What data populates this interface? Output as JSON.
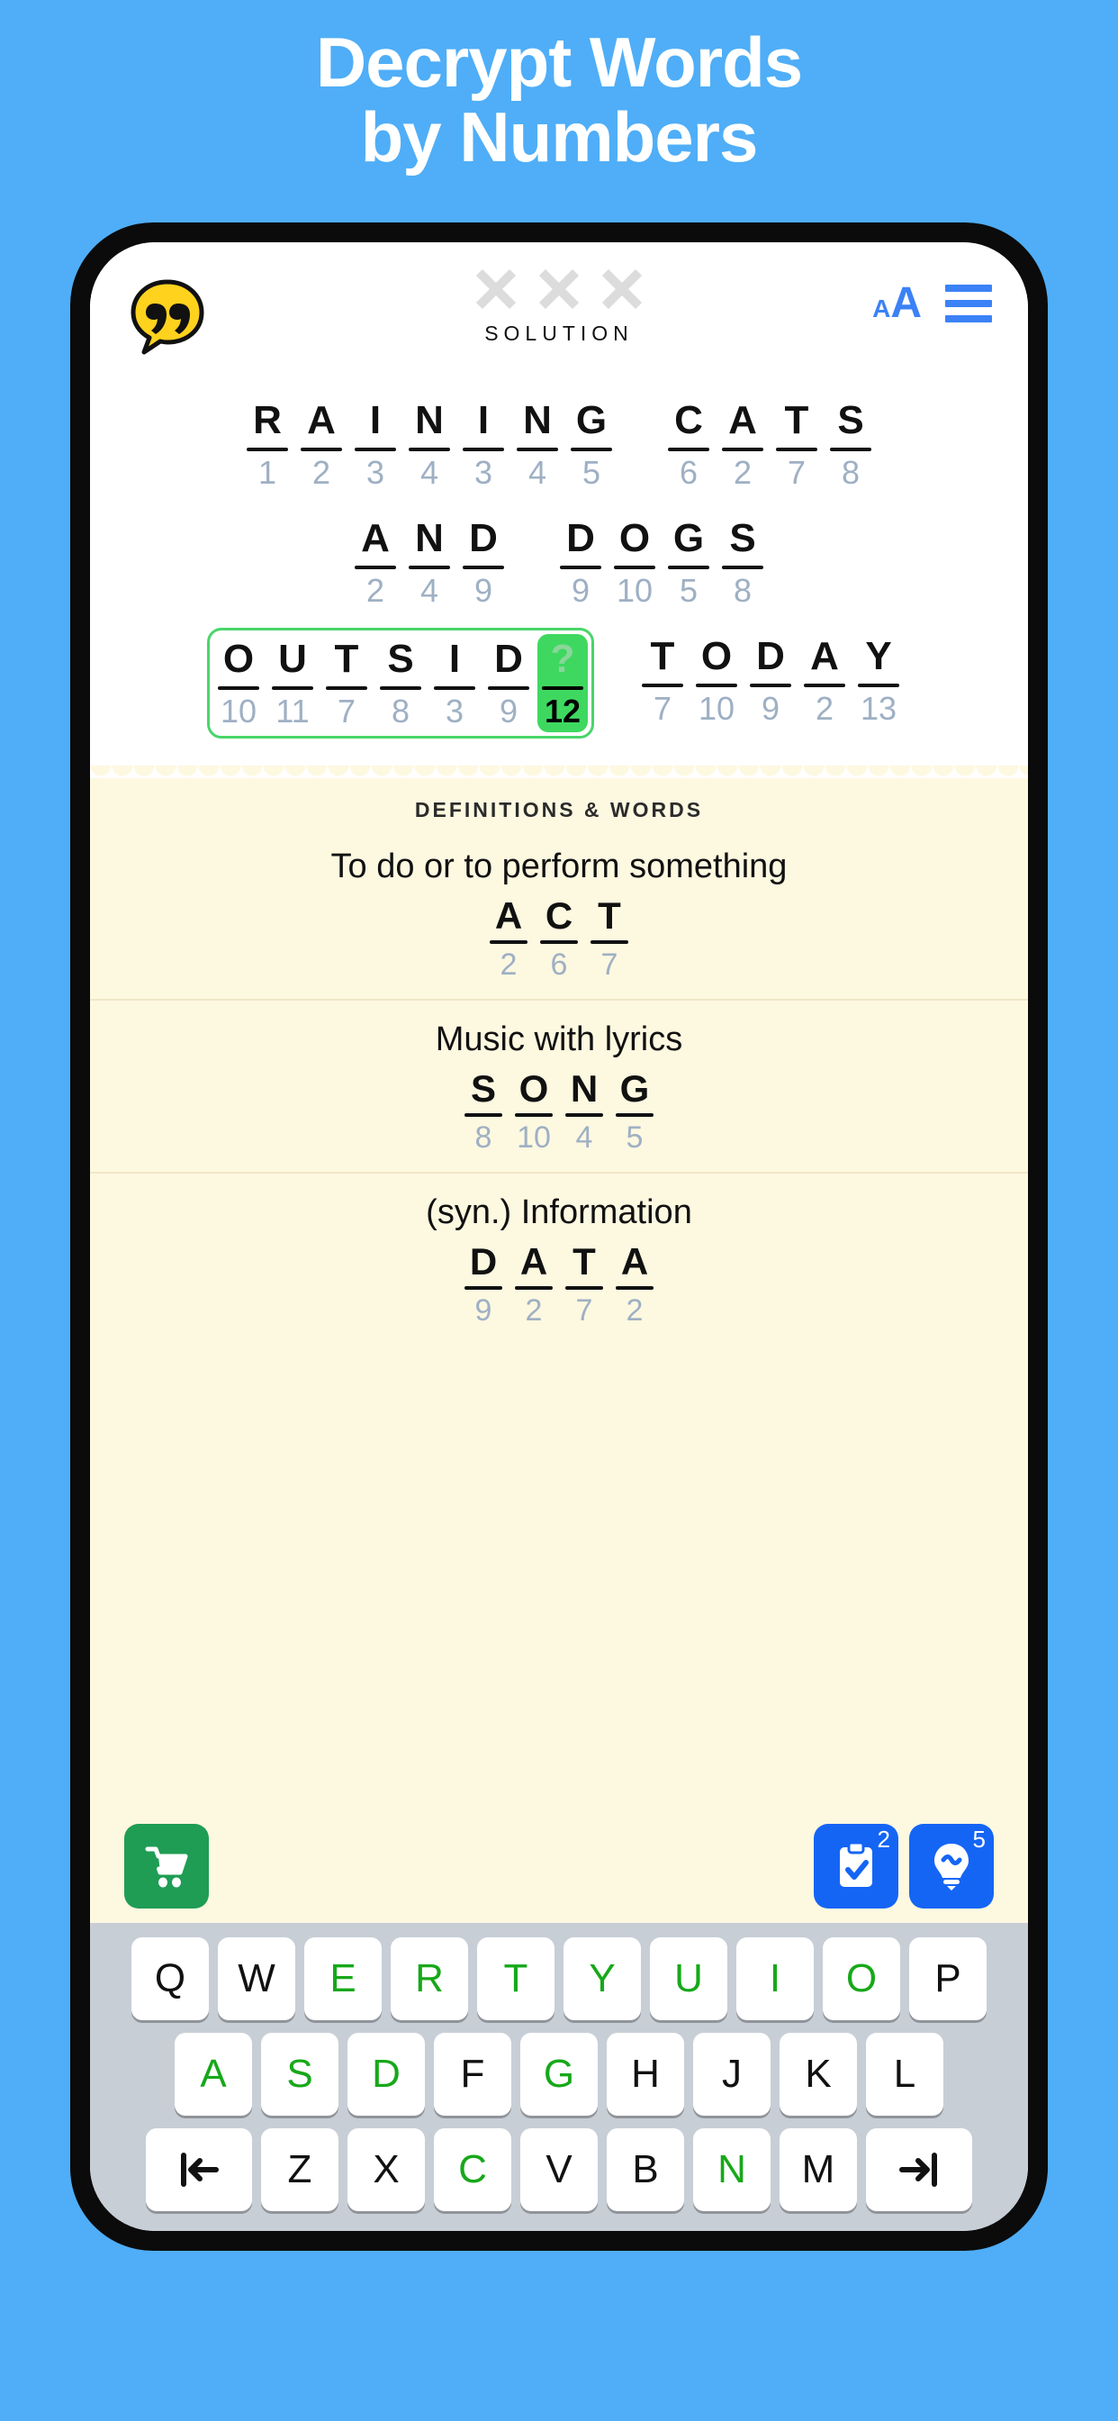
{
  "promo": {
    "title": "Decrypt Words\nby Numbers"
  },
  "colors": {
    "background": "#4FAEF7",
    "accent_blue": "#3B82F6",
    "key_green": "#17A81A",
    "active_cell": "#3ED860",
    "paper": "#FDF8E0",
    "shop_green": "#1F9D55",
    "hint_blue": "#1565F5"
  },
  "header": {
    "quote_icon": "quote-bubble-icon",
    "mistake_marks": [
      "x-mark",
      "x-mark",
      "x-mark"
    ],
    "solution_label": "SOLUTION",
    "text_size_small": "A",
    "text_size_large": "A",
    "menu_icon": "hamburger-menu-icon"
  },
  "puzzle": {
    "rows": [
      {
        "words": [
          {
            "selected": false,
            "cells": [
              {
                "letter": "R",
                "num": "1"
              },
              {
                "letter": "A",
                "num": "2"
              },
              {
                "letter": "I",
                "num": "3"
              },
              {
                "letter": "N",
                "num": "4"
              },
              {
                "letter": "I",
                "num": "3"
              },
              {
                "letter": "N",
                "num": "4"
              },
              {
                "letter": "G",
                "num": "5"
              }
            ]
          },
          {
            "selected": false,
            "cells": [
              {
                "letter": "C",
                "num": "6"
              },
              {
                "letter": "A",
                "num": "2"
              },
              {
                "letter": "T",
                "num": "7"
              },
              {
                "letter": "S",
                "num": "8"
              }
            ]
          }
        ]
      },
      {
        "words": [
          {
            "selected": false,
            "cells": [
              {
                "letter": "A",
                "num": "2"
              },
              {
                "letter": "N",
                "num": "4"
              },
              {
                "letter": "D",
                "num": "9"
              }
            ]
          },
          {
            "selected": false,
            "cells": [
              {
                "letter": "D",
                "num": "9"
              },
              {
                "letter": "O",
                "num": "10"
              },
              {
                "letter": "G",
                "num": "5"
              },
              {
                "letter": "S",
                "num": "8"
              }
            ]
          }
        ]
      },
      {
        "words": [
          {
            "selected": true,
            "cells": [
              {
                "letter": "O",
                "num": "10"
              },
              {
                "letter": "U",
                "num": "11"
              },
              {
                "letter": "T",
                "num": "7"
              },
              {
                "letter": "S",
                "num": "8"
              },
              {
                "letter": "I",
                "num": "3"
              },
              {
                "letter": "D",
                "num": "9"
              },
              {
                "letter": "?",
                "num": "12",
                "active": true
              }
            ]
          },
          {
            "selected": false,
            "cells": [
              {
                "letter": "T",
                "num": "7"
              },
              {
                "letter": "O",
                "num": "10"
              },
              {
                "letter": "D",
                "num": "9"
              },
              {
                "letter": "A",
                "num": "2"
              },
              {
                "letter": "Y",
                "num": "13"
              }
            ]
          }
        ]
      }
    ]
  },
  "definitions": {
    "heading": "DEFINITIONS & WORDS",
    "items": [
      {
        "clue": "To do or to perform something",
        "cells": [
          {
            "letter": "A",
            "num": "2"
          },
          {
            "letter": "C",
            "num": "6"
          },
          {
            "letter": "T",
            "num": "7"
          }
        ]
      },
      {
        "clue": "Music with lyrics",
        "cells": [
          {
            "letter": "S",
            "num": "8"
          },
          {
            "letter": "O",
            "num": "10"
          },
          {
            "letter": "N",
            "num": "4"
          },
          {
            "letter": "G",
            "num": "5"
          }
        ]
      },
      {
        "clue": "(syn.) Information",
        "cells": [
          {
            "letter": "D",
            "num": "9"
          },
          {
            "letter": "A",
            "num": "2"
          },
          {
            "letter": "T",
            "num": "7"
          },
          {
            "letter": "A",
            "num": "2"
          }
        ]
      }
    ]
  },
  "actions": {
    "shop": {
      "icon": "shopping-cart-icon",
      "badge": ""
    },
    "check": {
      "icon": "clipboard-check-icon",
      "badge": "2"
    },
    "hint": {
      "icon": "lightbulb-icon",
      "badge": "5"
    }
  },
  "keyboard": {
    "rows": [
      [
        {
          "label": "Q",
          "used": false
        },
        {
          "label": "W",
          "used": false
        },
        {
          "label": "E",
          "used": true
        },
        {
          "label": "R",
          "used": true
        },
        {
          "label": "T",
          "used": true
        },
        {
          "label": "Y",
          "used": true
        },
        {
          "label": "U",
          "used": true
        },
        {
          "label": "I",
          "used": true
        },
        {
          "label": "O",
          "used": true
        },
        {
          "label": "P",
          "used": false
        }
      ],
      [
        {
          "label": "A",
          "used": true
        },
        {
          "label": "S",
          "used": true
        },
        {
          "label": "D",
          "used": true
        },
        {
          "label": "F",
          "used": false
        },
        {
          "label": "G",
          "used": true
        },
        {
          "label": "H",
          "used": false
        },
        {
          "label": "J",
          "used": false
        },
        {
          "label": "K",
          "used": false
        },
        {
          "label": "L",
          "used": false
        }
      ],
      [
        {
          "label": "prev",
          "icon": "arrow-to-left-icon",
          "used": false
        },
        {
          "label": "Z",
          "used": false
        },
        {
          "label": "X",
          "used": false
        },
        {
          "label": "C",
          "used": true
        },
        {
          "label": "V",
          "used": false
        },
        {
          "label": "B",
          "used": false
        },
        {
          "label": "N",
          "used": true
        },
        {
          "label": "M",
          "used": false
        },
        {
          "label": "next",
          "icon": "arrow-to-right-icon",
          "used": false
        }
      ]
    ]
  }
}
